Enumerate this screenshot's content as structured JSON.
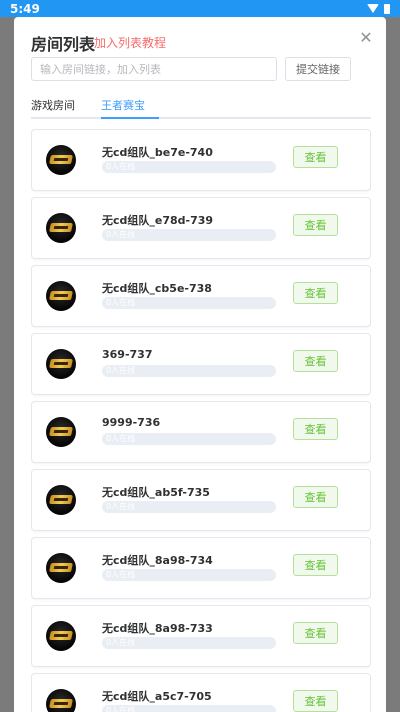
{
  "status_bar": {
    "time": "5:49"
  },
  "dialog": {
    "title": "房间列表",
    "tutorial_link": "加入列表教程",
    "search": {
      "placeholder": "输入房间链接，加入列表",
      "value": ""
    },
    "submit_label": "提交链接",
    "tabs": [
      {
        "label": "游戏房间",
        "active": false
      },
      {
        "label": "王者赛宝",
        "active": true
      }
    ]
  },
  "rooms": [
    {
      "name": "无cd组队_be7e-740",
      "people": "0人在线",
      "fill": 0,
      "button": "查看"
    },
    {
      "name": "无cd组队_e78d-739",
      "people": "0人在线",
      "fill": 0,
      "button": "查看"
    },
    {
      "name": "无cd组队_cb5e-738",
      "people": "0人在线",
      "fill": 0,
      "button": "查看"
    },
    {
      "name": "369-737",
      "people": "0人在线",
      "fill": 0,
      "button": "查看"
    },
    {
      "name": "9999-736",
      "people": "0人在线",
      "fill": 0,
      "button": "查看"
    },
    {
      "name": "无cd组队_ab5f-735",
      "people": "0人在线",
      "fill": 0,
      "button": "查看"
    },
    {
      "name": "无cd组队_8a98-734",
      "people": "0人在线",
      "fill": 0,
      "button": "查看"
    },
    {
      "name": "无cd组队_8a98-733",
      "people": "0人在线",
      "fill": 0,
      "button": "查看"
    },
    {
      "name": "无cd组队_a5c7-705",
      "people": "0人在线",
      "fill": 0,
      "button": "查看"
    }
  ],
  "colors": {
    "status_bar": "#2196f3",
    "accent": "#409eff",
    "link_red": "#f56c6c",
    "view_green": "#67c23a"
  },
  "icons": {
    "close": "close-icon",
    "wifi": "wifi-icon",
    "battery": "battery-icon"
  }
}
